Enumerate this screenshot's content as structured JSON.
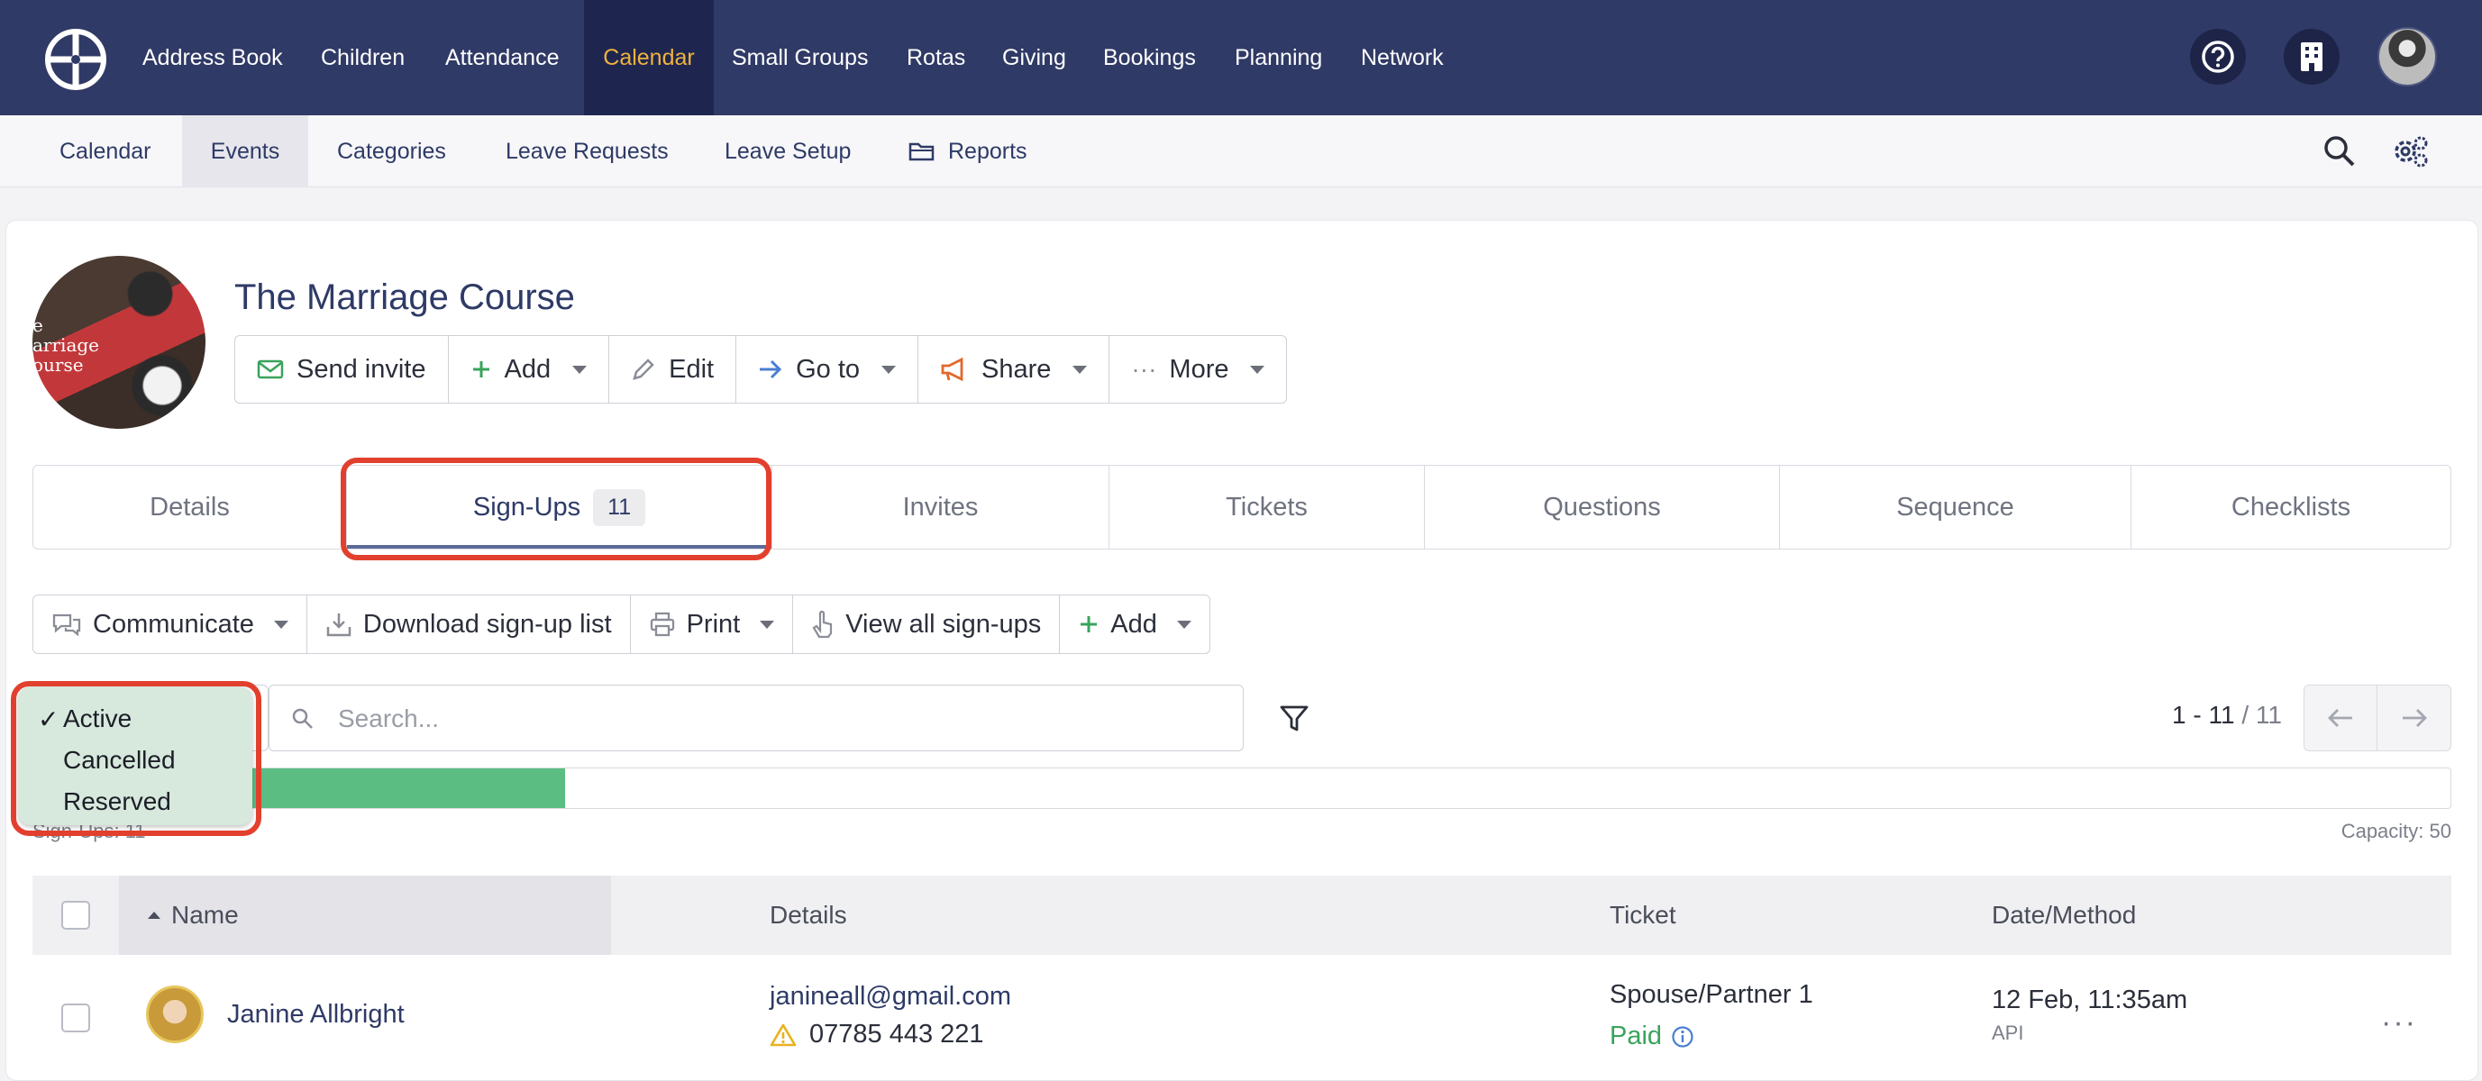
{
  "colors": {
    "nav_bg": "#303a66",
    "nav_active": "#f0b23e",
    "accent_green": "#5bbd82",
    "highlight_red": "#e2402e"
  },
  "topnav": {
    "logo_icon": "church-logo-icon",
    "items": [
      "Address Book",
      "Children",
      "Attendance",
      "Calendar",
      "Small Groups",
      "Rotas",
      "Giving",
      "Bookings",
      "Planning",
      "Network"
    ],
    "active": "Calendar",
    "icons": [
      "help-icon",
      "building-icon",
      "user-avatar"
    ]
  },
  "subnav": {
    "items": [
      "Calendar",
      "Events",
      "Categories",
      "Leave Requests",
      "Leave Setup",
      "Reports"
    ],
    "active": "Events",
    "icons": [
      "search-icon",
      "settings-icon"
    ]
  },
  "event": {
    "image_text": "e\narriage\nourse",
    "title": "The Marriage Course",
    "actions": [
      "Send invite",
      "Add",
      "Edit",
      "Go to",
      "Share",
      "More"
    ]
  },
  "tabs": {
    "items": [
      "Details",
      "Sign-Ups",
      "Invites",
      "Tickets",
      "Questions",
      "Sequence",
      "Checklists"
    ],
    "active": "Sign-Ups",
    "signups_count": "11"
  },
  "action_bar": [
    "Communicate",
    "Download sign-up list",
    "Print",
    "View all sign-ups",
    "Add"
  ],
  "status_dropdown": {
    "options": [
      "Active",
      "Cancelled",
      "Reserved"
    ],
    "selected": "Active",
    "check": "✓"
  },
  "search": {
    "placeholder": "Search..."
  },
  "pagination": {
    "range": "1 - 11",
    "total": "/ 11"
  },
  "capacity": {
    "label": "Capacity: 50",
    "signups_label": "Sign-Ups: 11",
    "filled": 11,
    "max": 50
  },
  "table": {
    "headers": [
      "Name",
      "Details",
      "Ticket",
      "Date/Method"
    ],
    "rows": [
      {
        "name": "Janine Allbright",
        "email": "janineall@gmail.com",
        "phone": "07785 443 221",
        "ticket": "Spouse/Partner 1",
        "payment_status": "Paid",
        "date": "12 Feb, 11:35am",
        "method": "API",
        "menu": "···"
      }
    ]
  }
}
